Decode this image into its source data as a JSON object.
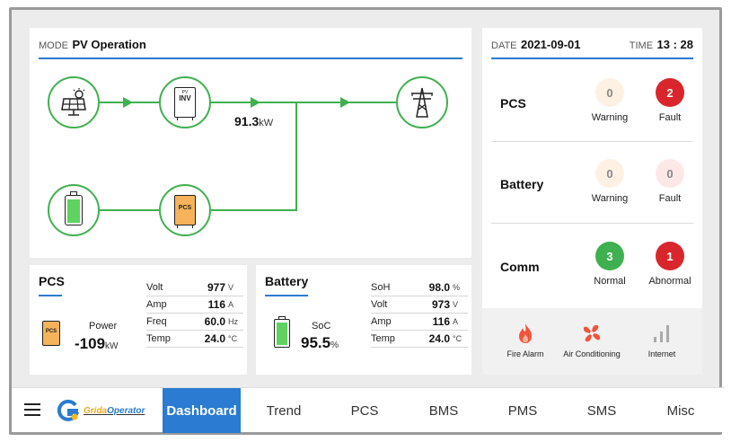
{
  "mode": {
    "label": "MODE",
    "value": "PV Operation"
  },
  "flow": {
    "inv_label": "INV",
    "inv_top": "PV",
    "power_value": "91.3",
    "power_unit": "kW",
    "pcs_label": "PCS"
  },
  "datetime": {
    "date_label": "DATE",
    "date": "2021-09-01",
    "time_label": "TIME",
    "time": "13 : 28"
  },
  "status": {
    "pcs": {
      "label": "PCS",
      "warning_count": "0",
      "warning_label": "Warning",
      "fault_count": "2",
      "fault_label": "Fault"
    },
    "battery": {
      "label": "Battery",
      "warning_count": "0",
      "warning_label": "Warning",
      "fault_count": "0",
      "fault_label": "Fault"
    },
    "comm": {
      "label": "Comm",
      "normal_count": "3",
      "normal_label": "Normal",
      "abnormal_count": "1",
      "abnormal_label": "Abnormal"
    }
  },
  "pcs_card": {
    "title": "PCS",
    "icon_label": "PCS",
    "power_label": "Power",
    "power_value": "-109",
    "power_unit": "kW",
    "rows": [
      {
        "key": "Volt",
        "value": "977",
        "unit": "V"
      },
      {
        "key": "Amp",
        "value": "116",
        "unit": "A"
      },
      {
        "key": "Freq",
        "value": "60.0",
        "unit": "Hz"
      },
      {
        "key": "Temp",
        "value": "24.0",
        "unit": "°C"
      }
    ]
  },
  "battery_card": {
    "title": "Battery",
    "soc_label": "SoC",
    "soc_value": "95.5",
    "soc_unit": "%",
    "rows": [
      {
        "key": "SoH",
        "value": "98.0",
        "unit": "%"
      },
      {
        "key": "Volt",
        "value": "973",
        "unit": "V"
      },
      {
        "key": "Amp",
        "value": "116",
        "unit": "A"
      },
      {
        "key": "Temp",
        "value": "24.0",
        "unit": "°C"
      }
    ]
  },
  "alarms": {
    "fire": "Fire Alarm",
    "ac": "Air Conditioning",
    "internet": "Internet"
  },
  "nav": {
    "brand": "GridaOperator",
    "brand_prefix": "Grida",
    "brand_suffix": "Operator",
    "items": [
      "Dashboard",
      "Trend",
      "PCS",
      "BMS",
      "PMS",
      "SMS",
      "Misc"
    ],
    "active": "Dashboard"
  },
  "colors": {
    "accent": "#2a7bd1",
    "flow_green": "#3fb04f",
    "fault_red": "#d9262c",
    "normal_green": "#3fb04f",
    "warning_bg": "#fdf1e4",
    "zero_fault_bg": "#fde8e8"
  }
}
